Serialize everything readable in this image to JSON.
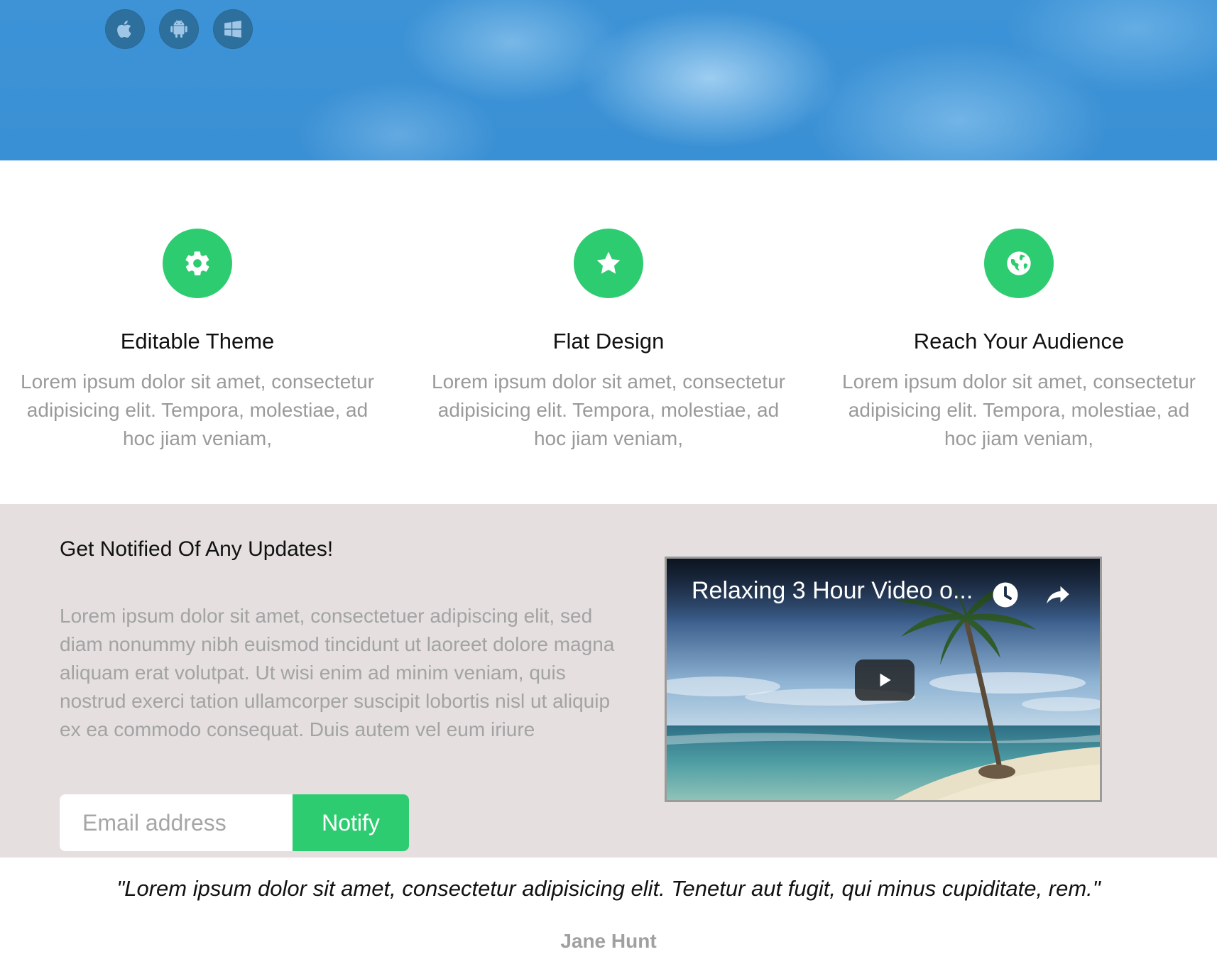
{
  "hero": {
    "platforms": [
      {
        "icon": "apple-icon"
      },
      {
        "icon": "android-icon"
      },
      {
        "icon": "windows-icon"
      }
    ]
  },
  "features": [
    {
      "icon": "gear-icon",
      "title": "Editable Theme",
      "text": "Lorem ipsum dolor sit amet, consectetur adipisicing elit. Tempora, molestiae, ad hoc jiam veniam,"
    },
    {
      "icon": "star-icon",
      "title": "Flat Design",
      "text": "Lorem ipsum dolor sit amet, consectetur adipisicing elit. Tempora, molestiae, ad hoc jiam veniam,"
    },
    {
      "icon": "globe-icon",
      "title": "Reach Your Audience",
      "text": "Lorem ipsum dolor sit amet, consectetur adipisicing elit. Tempora, molestiae, ad hoc jiam veniam,"
    }
  ],
  "notify": {
    "heading": "Get Notified Of Any Updates!",
    "body": "Lorem ipsum dolor sit amet, consectetuer adipiscing elit, sed diam nonummy nibh euismod tincidunt ut laoreet dolore magna aliquam erat volutpat. Ut wisi enim ad minim veniam, quis nostrud exerci tation ullamcorper suscipit lobortis nisl ut aliquip ex ea commodo consequat. Duis autem vel eum iriure",
    "email_placeholder": "Email address",
    "button_label": "Notify"
  },
  "video": {
    "title": "Relaxing 3 Hour Video o...",
    "icons": [
      "clock-icon",
      "share-icon",
      "play-icon"
    ]
  },
  "testimonial": {
    "quote": "\"Lorem ipsum dolor sit amet, consectetur adipisicing elit. Tenetur aut fugit, qui minus cupiditate, rem.\"",
    "author": "Jane Hunt"
  },
  "colors": {
    "accent": "#2ecc71",
    "hero_blue": "#3a90d4",
    "platform_circle": "#2d6f9d",
    "notify_bg": "#e5dfdf"
  }
}
